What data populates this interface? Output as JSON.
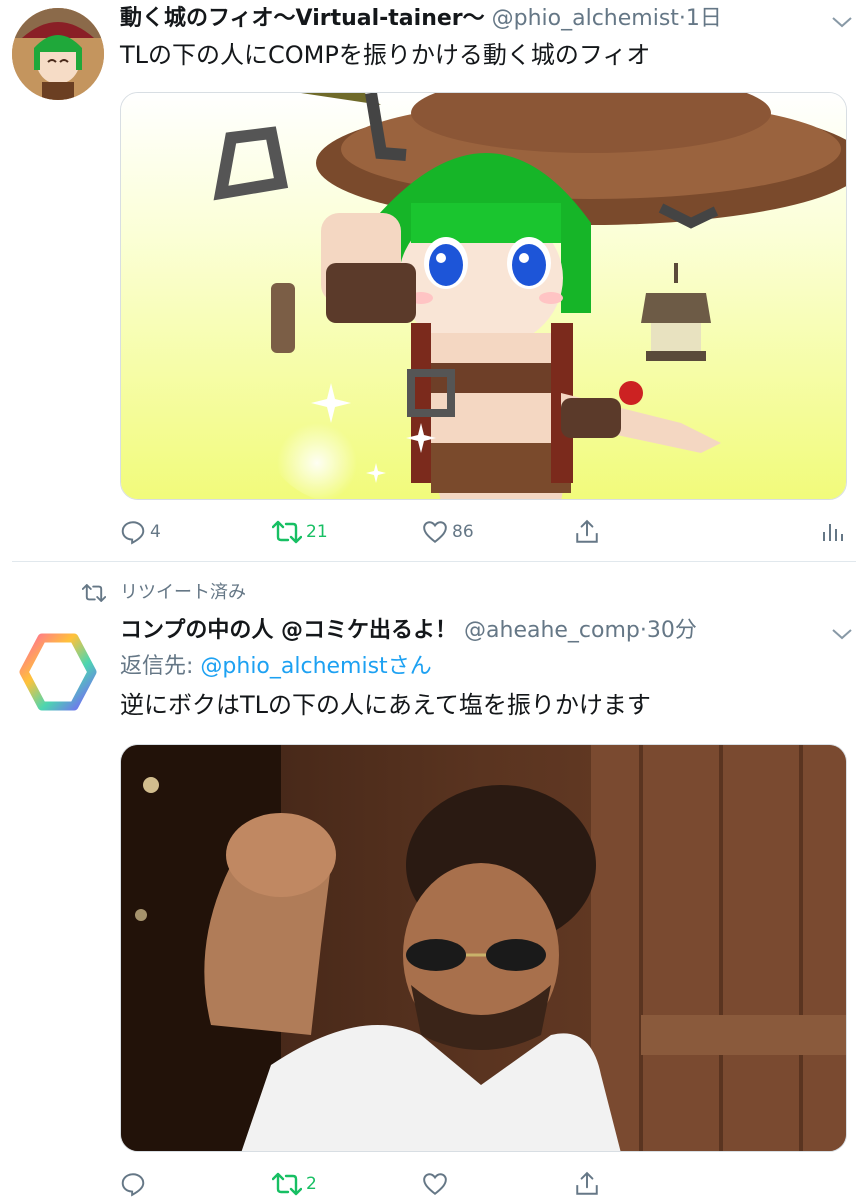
{
  "tweet1": {
    "display_name": "動く城のフィオ〜Virtual-tainer〜",
    "handle": "@phio_alchemist",
    "sep": "·",
    "time": "1日",
    "text": "TLの下の人にCOMPを振りかける動く城のフィオ",
    "replies": "4",
    "retweets": "21",
    "likes": "86",
    "icons": [
      "reply-icon",
      "retweet-icon",
      "heart-icon",
      "share-icon",
      "analytics-icon",
      "chevron-down-icon"
    ]
  },
  "retweet_banner": "リツイート済み",
  "tweet2": {
    "display_name": "コンプの中の人 @コミケ出るよ！",
    "handle": "@aheahe_comp",
    "sep": "·",
    "time": "30分",
    "reply_prefix": "返信先: ",
    "reply_mention": "@phio_alchemist",
    "reply_suffix": "さん",
    "text": "逆にボクはTLの下の人にあえて塩を振りかけます",
    "retweets": "2",
    "icons": [
      "reply-icon",
      "retweet-icon",
      "heart-icon",
      "share-icon",
      "chevron-down-icon"
    ]
  },
  "colors": {
    "text": "#14171a",
    "secondary": "#657786",
    "link": "#1da1f2",
    "retweet_active": "#17bf63",
    "divider": "#e1e8ed"
  }
}
